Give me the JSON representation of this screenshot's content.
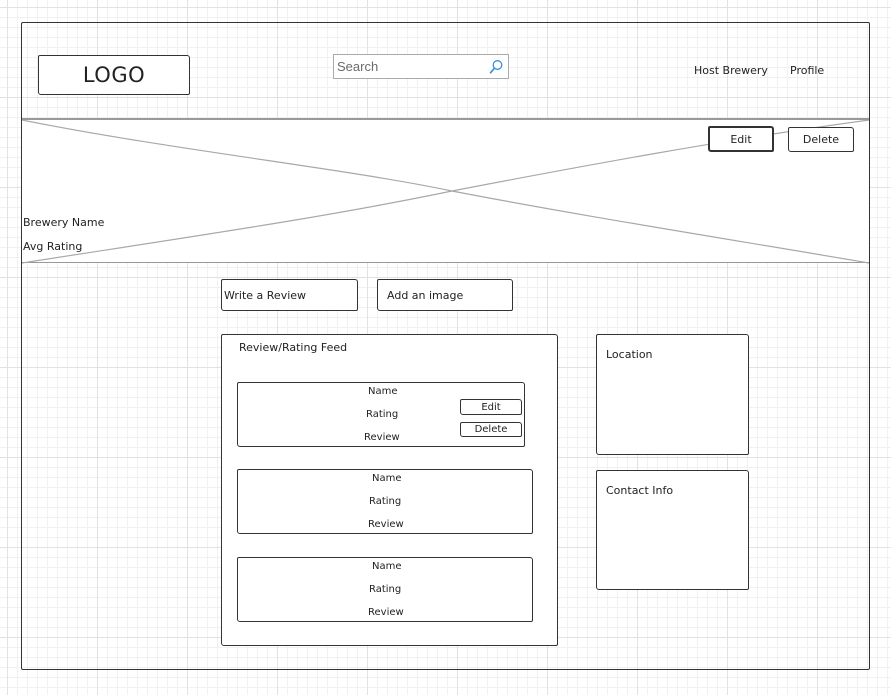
{
  "header": {
    "logo_text": "LOGO",
    "search": {
      "placeholder": "Search"
    },
    "nav": {
      "host_brewery": "Host Brewery",
      "profile": "Profile"
    }
  },
  "banner": {
    "edit_label": "Edit",
    "delete_label": "Delete",
    "brewery_name": "Brewery Name",
    "avg_rating": "Avg Rating"
  },
  "actions": {
    "write_review": "Write a Review",
    "add_image": "Add an image"
  },
  "feed": {
    "title": "Review/Rating Feed",
    "reviews": [
      {
        "name": "Name",
        "rating": "Rating",
        "review": "Review",
        "edit": "Edit",
        "delete": "Delete"
      },
      {
        "name": "Name",
        "rating": "Rating",
        "review": "Review"
      },
      {
        "name": "Name",
        "rating": "Rating",
        "review": "Review"
      }
    ]
  },
  "sidebar": {
    "location_title": "Location",
    "contact_title": "Contact Info"
  }
}
